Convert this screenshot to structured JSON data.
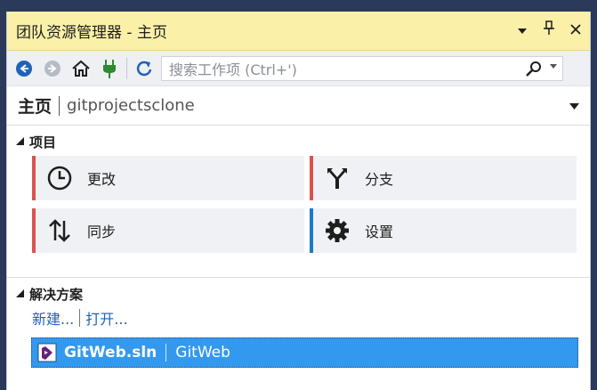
{
  "window": {
    "title": "团队资源管理器 - 主页",
    "buttons": {
      "dropdown": "▼",
      "pin": "弓",
      "close": "✕"
    }
  },
  "toolbar": {
    "search_placeholder": "搜索工作项 (Ctrl+')"
  },
  "header": {
    "title": "主页",
    "subtitle": "gitprojectsclone"
  },
  "projects": {
    "heading": "项目",
    "tiles": [
      {
        "label": "更改",
        "icon": "clock-icon",
        "accent": "#d9534f"
      },
      {
        "label": "分支",
        "icon": "branch-icon",
        "accent": "#d9534f"
      },
      {
        "label": "同步",
        "icon": "sync-arrows-icon",
        "accent": "#d9534f"
      },
      {
        "label": "设置",
        "icon": "gear-icon",
        "accent": "#1e79c6"
      }
    ]
  },
  "solutions": {
    "heading": "解决方案",
    "new_link": "新建...",
    "open_link": "打开...",
    "items": [
      {
        "name": "GitWeb.sln",
        "project": "GitWeb"
      }
    ]
  },
  "colors": {
    "titlebar": "#fbf0a8",
    "selection": "#3399ee",
    "link": "#1e62b8"
  }
}
